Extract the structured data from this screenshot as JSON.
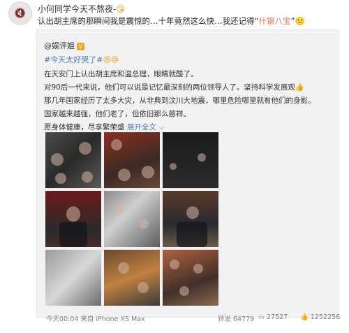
{
  "post": {
    "username": "小何同学今天不熬夜-",
    "username_emoji": "😘",
    "text_before": "认出胡主席的那瞬间我是震惊的…十年竟然这么快…我还记得“",
    "text_highlight": "什锦八宝",
    "text_after": "”",
    "text_emoji": "🙁"
  },
  "repost": {
    "author": "@娱评姐",
    "verified_badge": "V",
    "topic": "#今天太好哭了#",
    "topic_emojis": "😢😢",
    "lines": [
      "在天安门上认出胡主席和温总理，眼睛就酸了。",
      "对90后一代来说，他们可以说是记忆最深刻的两位领导人了。坚持科学发展观👍",
      "那几年国家经历了太多大灾，从非典到汶川大地震，哪里危险哪里就有他们的身影。",
      "国家越来越强，他们老了，但依旧那么慈祥。"
    ],
    "last_line": "愿身体健康，尽享繁荣盛",
    "expand_label": "展开全文",
    "expand_icon": "chevron-down-icon"
  },
  "footer": {
    "time": "今天00:04 来自 iPhone XS Max",
    "reposts": "64779",
    "comments": "27527",
    "likes": "1252256"
  },
  "colors": {
    "link": "#507daf",
    "highlight": "#eb7350",
    "repost_bg": "#f2f2f5"
  }
}
